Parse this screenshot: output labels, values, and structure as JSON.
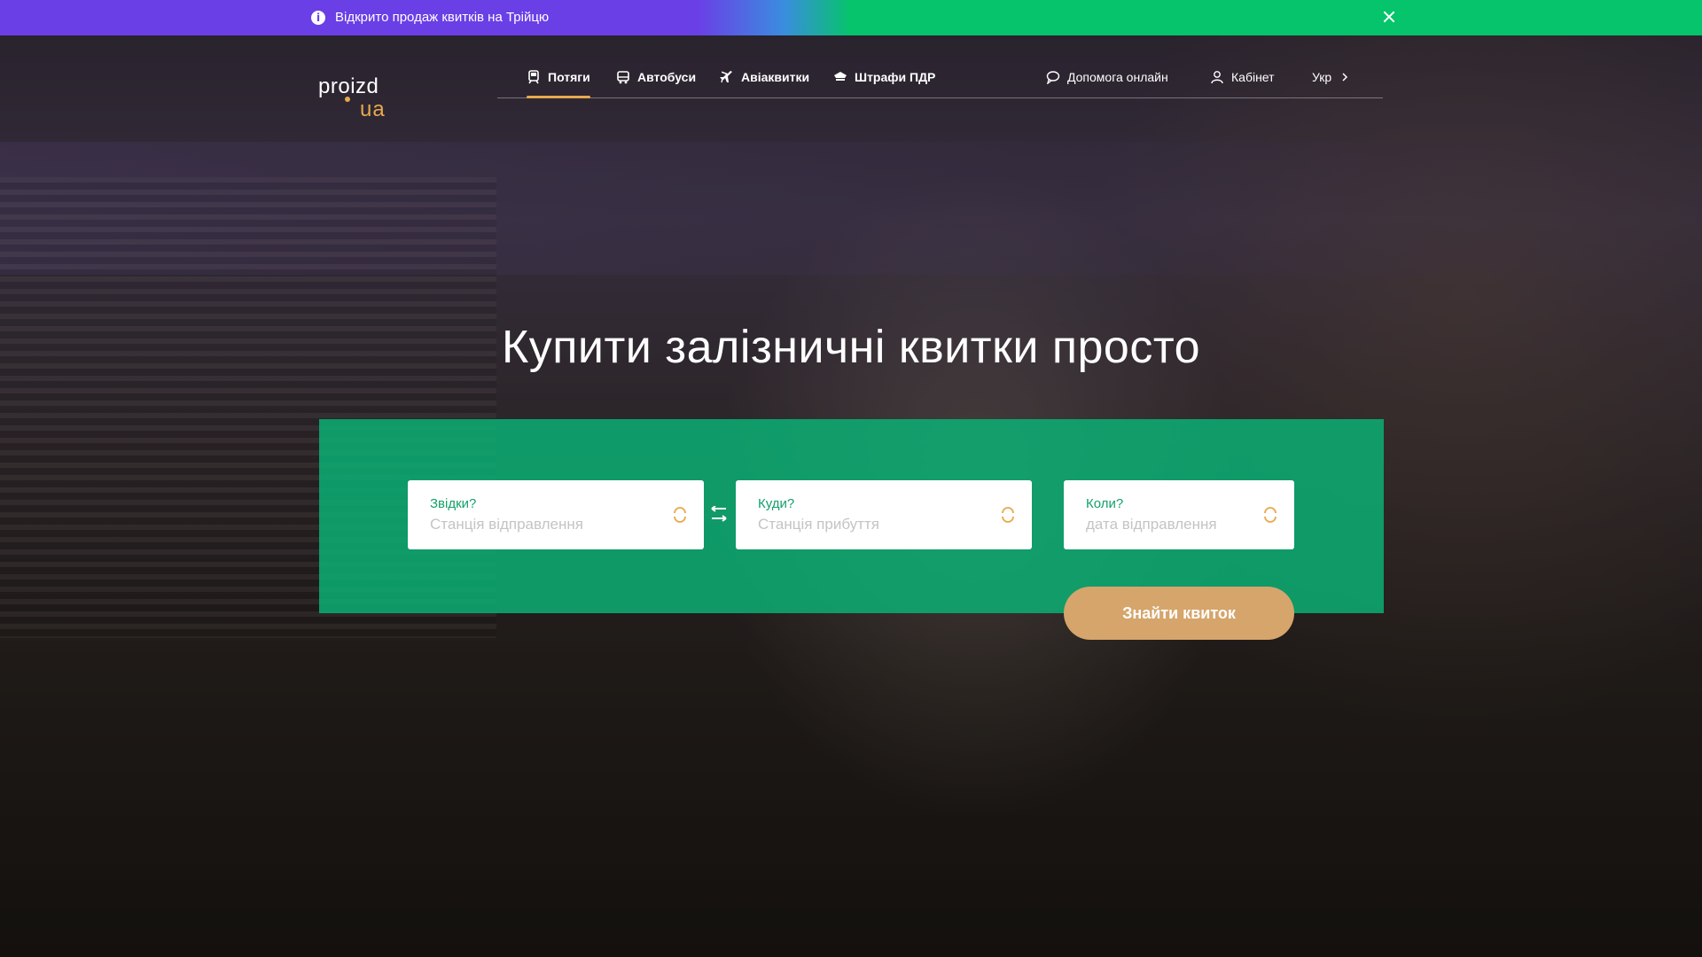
{
  "announcement": {
    "text": "Відкрито продаж квитків на Трійцю",
    "info_icon": "info-icon",
    "close_icon": "close-icon"
  },
  "logo": {
    "line1": "proizd",
    "line2": "ua"
  },
  "nav": {
    "items": [
      {
        "label": "Потяги",
        "icon": "train-icon",
        "active": true
      },
      {
        "label": "Автобуси",
        "icon": "bus-icon",
        "active": false
      },
      {
        "label": "Авіаквитки",
        "icon": "plane-icon",
        "active": false
      },
      {
        "label": "Штрафи ПДР",
        "icon": "police-cap-icon",
        "active": false
      }
    ],
    "help": {
      "label": "Допомога онлайн",
      "icon": "chat-bubble-icon"
    },
    "cabinet": {
      "label": "Кабінет",
      "icon": "user-icon"
    },
    "language": {
      "label": "Укр",
      "icon": "chevron-right-icon"
    }
  },
  "hero": {
    "title": "Купити залізничні квитки просто"
  },
  "search": {
    "from": {
      "label": "Звідки?",
      "placeholder": "Станція відправлення"
    },
    "to": {
      "label": "Куди?",
      "placeholder": "Станція прибуття"
    },
    "date": {
      "label": "Коли?",
      "placeholder": "дата відправлення"
    },
    "swap_icon": "swap-arrows-icon",
    "submit_label": "Знайти квиток"
  },
  "colors": {
    "announcement_purple": "#6a3fe6",
    "announcement_green": "#05c46b",
    "panel_green": "#0ab478",
    "accent_orange": "#e8a94d",
    "button_tan": "#d6a56b",
    "field_label_green": "#14a06a"
  }
}
